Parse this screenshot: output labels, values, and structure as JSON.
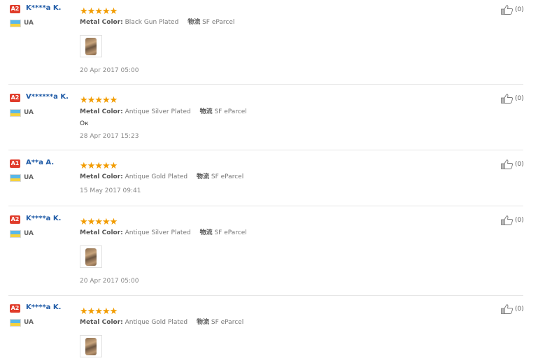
{
  "reviews": [
    {
      "badge": "A2",
      "name": "K****a K.",
      "country": "UA",
      "rating": 5,
      "attr_label": "Metal Color:",
      "attr_value": "Black Gun Plated",
      "ship_label": "物流",
      "ship_value": "SF eParcel",
      "comment": "",
      "has_photo": true,
      "date": "20 Apr 2017 05:00",
      "likes": "(0)"
    },
    {
      "badge": "A2",
      "name": "V******a K.",
      "country": "UA",
      "rating": 5,
      "attr_label": "Metal Color:",
      "attr_value": "Antique Silver Plated",
      "ship_label": "物流",
      "ship_value": "SF eParcel",
      "comment": "Ок",
      "has_photo": false,
      "date": "28 Apr 2017 15:23",
      "likes": "(0)"
    },
    {
      "badge": "A1",
      "name": "A**a A.",
      "country": "UA",
      "rating": 5,
      "attr_label": "Metal Color:",
      "attr_value": "Antique Gold Plated",
      "ship_label": "物流",
      "ship_value": "SF eParcel",
      "comment": "",
      "has_photo": false,
      "date": "15 May 2017 09:41",
      "likes": "(0)"
    },
    {
      "badge": "A2",
      "name": "K****a K.",
      "country": "UA",
      "rating": 5,
      "attr_label": "Metal Color:",
      "attr_value": "Antique Silver Plated",
      "ship_label": "物流",
      "ship_value": "SF eParcel",
      "comment": "",
      "has_photo": true,
      "date": "20 Apr 2017 05:00",
      "likes": "(0)"
    },
    {
      "badge": "A2",
      "name": "K****a K.",
      "country": "UA",
      "rating": 5,
      "attr_label": "Metal Color:",
      "attr_value": "Antique Gold Plated",
      "ship_label": "物流",
      "ship_value": "SF eParcel",
      "comment": "",
      "has_photo": true,
      "date": "",
      "likes": "(0)"
    }
  ],
  "icons": {
    "star": "star-icon",
    "like": "thumbs-up-icon",
    "flag": "ukraine-flag-icon"
  },
  "colors": {
    "badge": "#e03c2b",
    "name": "#1e5aa6",
    "star": "#f29c00"
  }
}
